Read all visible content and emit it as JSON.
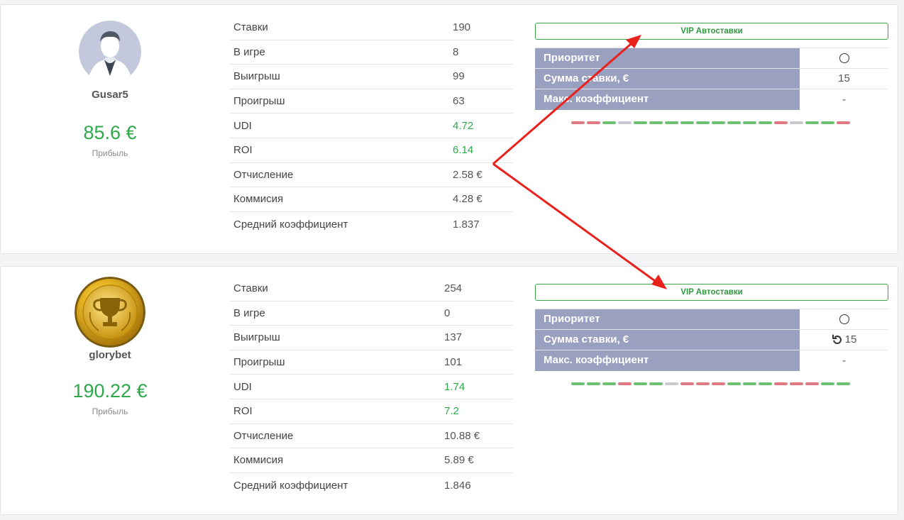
{
  "colors": {
    "win": "#6cc273",
    "loss": "#e07a80",
    "neutral": "#c9c9cf",
    "accent_green": "#2ea84a",
    "vip_key_bg": "#9aa0bf",
    "arrow": "#e8211c"
  },
  "users": [
    {
      "avatar": "default-user-avatar",
      "username": "Gusar5",
      "profit": "85.6 €",
      "profit_label": "Прибыль",
      "stats": [
        {
          "label": "Ставки",
          "value": "190",
          "highlight": false
        },
        {
          "label": "В игре",
          "value": "8",
          "highlight": false
        },
        {
          "label": "Выигрыш",
          "value": "99",
          "highlight": false
        },
        {
          "label": "Проигрыш",
          "value": "63",
          "highlight": false
        },
        {
          "label": "UDI",
          "value": "4.72",
          "highlight": true
        },
        {
          "label": "ROI",
          "value": "6.14",
          "highlight": true
        },
        {
          "label": "Отчисление",
          "value": "2.58 €",
          "highlight": false
        },
        {
          "label": "Коммисия",
          "value": "4.28 €",
          "highlight": false
        },
        {
          "label": "Средний коэффициент",
          "value": "1.837",
          "highlight": false
        }
      ],
      "vip": {
        "button_label": "VIP Автоставки",
        "rows": [
          {
            "key": "Приоритет",
            "value": "",
            "icon": "radio-icon"
          },
          {
            "key": "Сумма ставки, €",
            "value": "15",
            "icon": ""
          },
          {
            "key": "Макс. коэффициент",
            "value": "-",
            "icon": ""
          }
        ],
        "history": [
          "loss",
          "loss",
          "win",
          "neutral",
          "win",
          "win",
          "win",
          "win",
          "win",
          "win",
          "win",
          "win",
          "win",
          "loss",
          "neutral",
          "win",
          "win",
          "loss"
        ]
      }
    },
    {
      "avatar": "gold-trophy-avatar",
      "username": "glorybet",
      "profit": "190.22 €",
      "profit_label": "Прибыль",
      "stats": [
        {
          "label": "Ставки",
          "value": "254",
          "highlight": false
        },
        {
          "label": "В игре",
          "value": "0",
          "highlight": false
        },
        {
          "label": "Выигрыш",
          "value": "137",
          "highlight": false
        },
        {
          "label": "Проигрыш",
          "value": "101",
          "highlight": false
        },
        {
          "label": "UDI",
          "value": "1.74",
          "highlight": true
        },
        {
          "label": "ROI",
          "value": "7.2",
          "highlight": true
        },
        {
          "label": "Отчисление",
          "value": "10.88 €",
          "highlight": false
        },
        {
          "label": "Коммисия",
          "value": "5.89 €",
          "highlight": false
        },
        {
          "label": "Средний коэффициент",
          "value": "1.846",
          "highlight": false
        }
      ],
      "vip": {
        "button_label": "VIP Автоставки",
        "rows": [
          {
            "key": "Приоритет",
            "value": "",
            "icon": "radio-icon"
          },
          {
            "key": "Сумма ставки, €",
            "value": "15",
            "icon": "undo-icon"
          },
          {
            "key": "Макс. коэффициент",
            "value": "-",
            "icon": ""
          }
        ],
        "history": [
          "win",
          "win",
          "win",
          "loss",
          "win",
          "win",
          "neutral",
          "loss",
          "loss",
          "loss",
          "win",
          "win",
          "win",
          "loss",
          "loss",
          "loss",
          "win",
          "win"
        ]
      }
    }
  ]
}
